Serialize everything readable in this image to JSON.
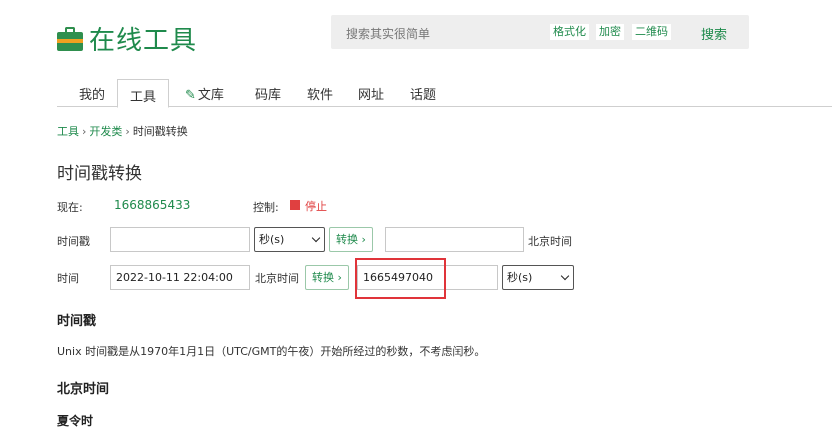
{
  "header": {
    "logo_text": "在线工具",
    "search_placeholder": "搜索其实很简单",
    "search_chips": [
      "格式化",
      "加密",
      "二维码"
    ],
    "search_button": "搜索"
  },
  "nav": {
    "items": [
      "我的",
      "工具",
      "文库",
      "码库",
      "软件",
      "网址",
      "话题"
    ],
    "active": "工具"
  },
  "breadcrumb": {
    "items": [
      "工具",
      "开发类",
      "时间戳转换"
    ],
    "separator": "›"
  },
  "page": {
    "title": "时间戳转换"
  },
  "now_row": {
    "label": "现在:",
    "value": "1668865433",
    "control_label": "控制:",
    "stop_label": "停止"
  },
  "ts_row": {
    "label": "时间戳",
    "input_value": "",
    "unit_select": "秒(s)",
    "convert_button": "转换 ›",
    "result_value": "",
    "result_suffix": "北京时间"
  },
  "time_row": {
    "label": "时间",
    "input_value": "2022-10-11 22:04:00",
    "input_suffix": "北京时间",
    "convert_button": "转换 ›",
    "result_value": "1665497040",
    "unit_select": "秒(s)"
  },
  "sections": {
    "timestamp_heading": "时间戳",
    "timestamp_desc": "Unix 时间戳是从1970年1月1日（UTC/GMT的午夜）开始所经过的秒数，不考虑闰秒。",
    "beijing_heading": "北京时间",
    "dst_heading": "夏令时"
  },
  "colors": {
    "brand_green": "#1f8a4c",
    "stop_red": "#e04040",
    "highlight_red": "#e0343a"
  }
}
